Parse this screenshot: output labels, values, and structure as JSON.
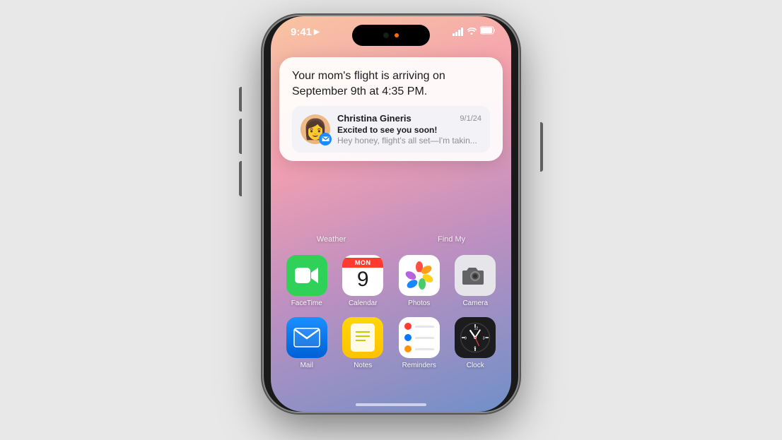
{
  "phone": {
    "status_bar": {
      "time": "9:41",
      "location_arrow": "▶",
      "battery": "100"
    },
    "notification": {
      "main_text": "Your mom's flight is arriving on September 9th at 4:35 PM.",
      "sender": "Christina Gineris",
      "date": "9/1/24",
      "subject": "Excited to see you soon!",
      "preview": "Hey honey, flight's all set—I'm takin..."
    },
    "widgets": {
      "weather_label": "Weather",
      "findmy_label": "Find My"
    },
    "apps": [
      {
        "name": "FaceTime",
        "icon_type": "facetime"
      },
      {
        "name": "Calendar",
        "icon_type": "calendar",
        "day_name": "MON",
        "day_number": "9"
      },
      {
        "name": "Photos",
        "icon_type": "photos"
      },
      {
        "name": "Camera",
        "icon_type": "camera"
      },
      {
        "name": "Mail",
        "icon_type": "mail"
      },
      {
        "name": "Notes",
        "icon_type": "notes"
      },
      {
        "name": "Reminders",
        "icon_type": "reminders"
      },
      {
        "name": "Clock",
        "icon_type": "clock"
      }
    ]
  }
}
